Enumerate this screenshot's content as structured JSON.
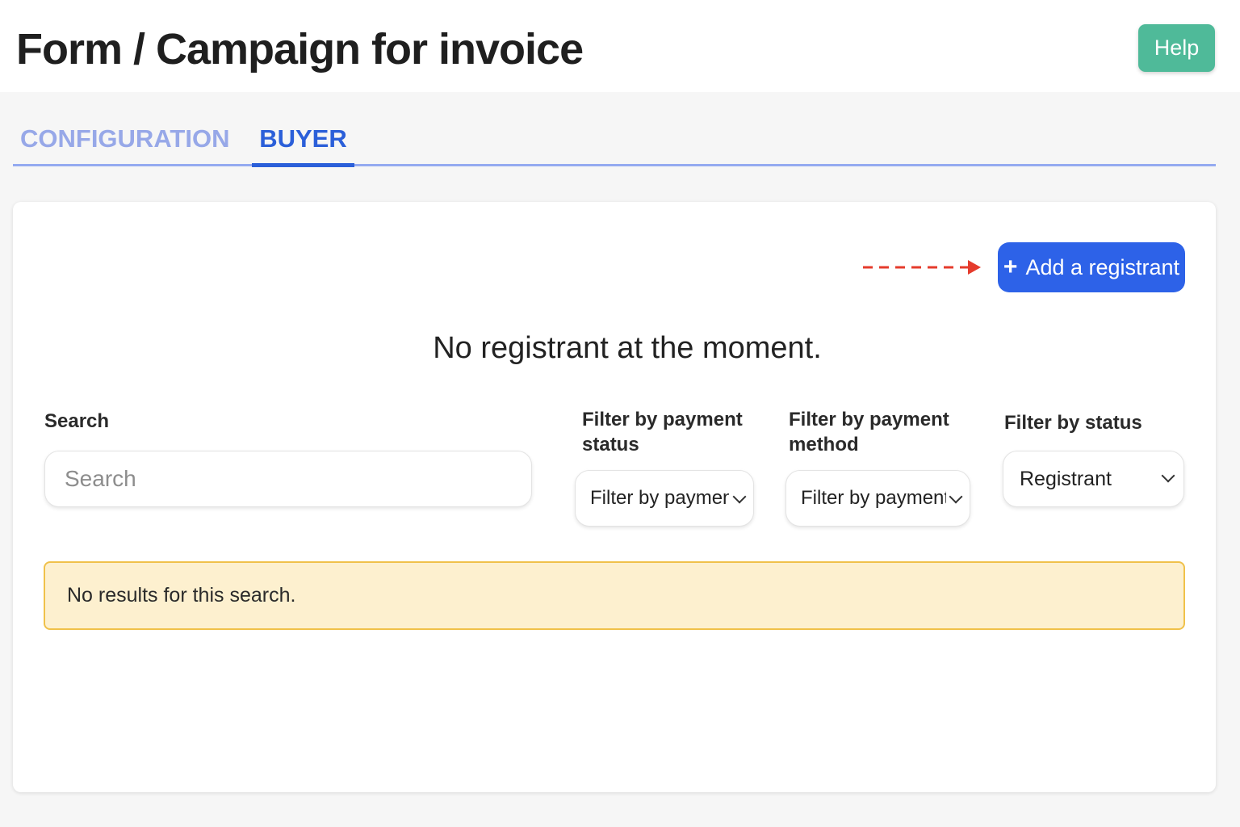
{
  "header": {
    "title": "Form / Campaign for invoice",
    "help_label": "Help"
  },
  "tabs": [
    {
      "label": "CONFIGURATION",
      "active": false
    },
    {
      "label": "BUYER",
      "active": true
    }
  ],
  "card": {
    "add_button": {
      "icon": "plus-icon",
      "label": "Add a registrant"
    },
    "empty_message": "No registrant at the moment.",
    "filters": {
      "search": {
        "label": "Search",
        "placeholder": "Search",
        "value": ""
      },
      "payment_status": {
        "label": "Filter by payment status",
        "selected": "Filter by payment status"
      },
      "payment_method": {
        "label": "Filter by payment method",
        "selected": "Filter by payment method"
      },
      "status": {
        "label": "Filter by status",
        "selected": "Registrant"
      }
    },
    "alert": "No results for this search."
  },
  "colors": {
    "accent": "#2d62e8",
    "help": "#4fba99",
    "tab_inactive": "#97a8e8",
    "arrow": "#e53b2c",
    "alert_bg": "#fdf0cf",
    "alert_border": "#f0c14a"
  }
}
